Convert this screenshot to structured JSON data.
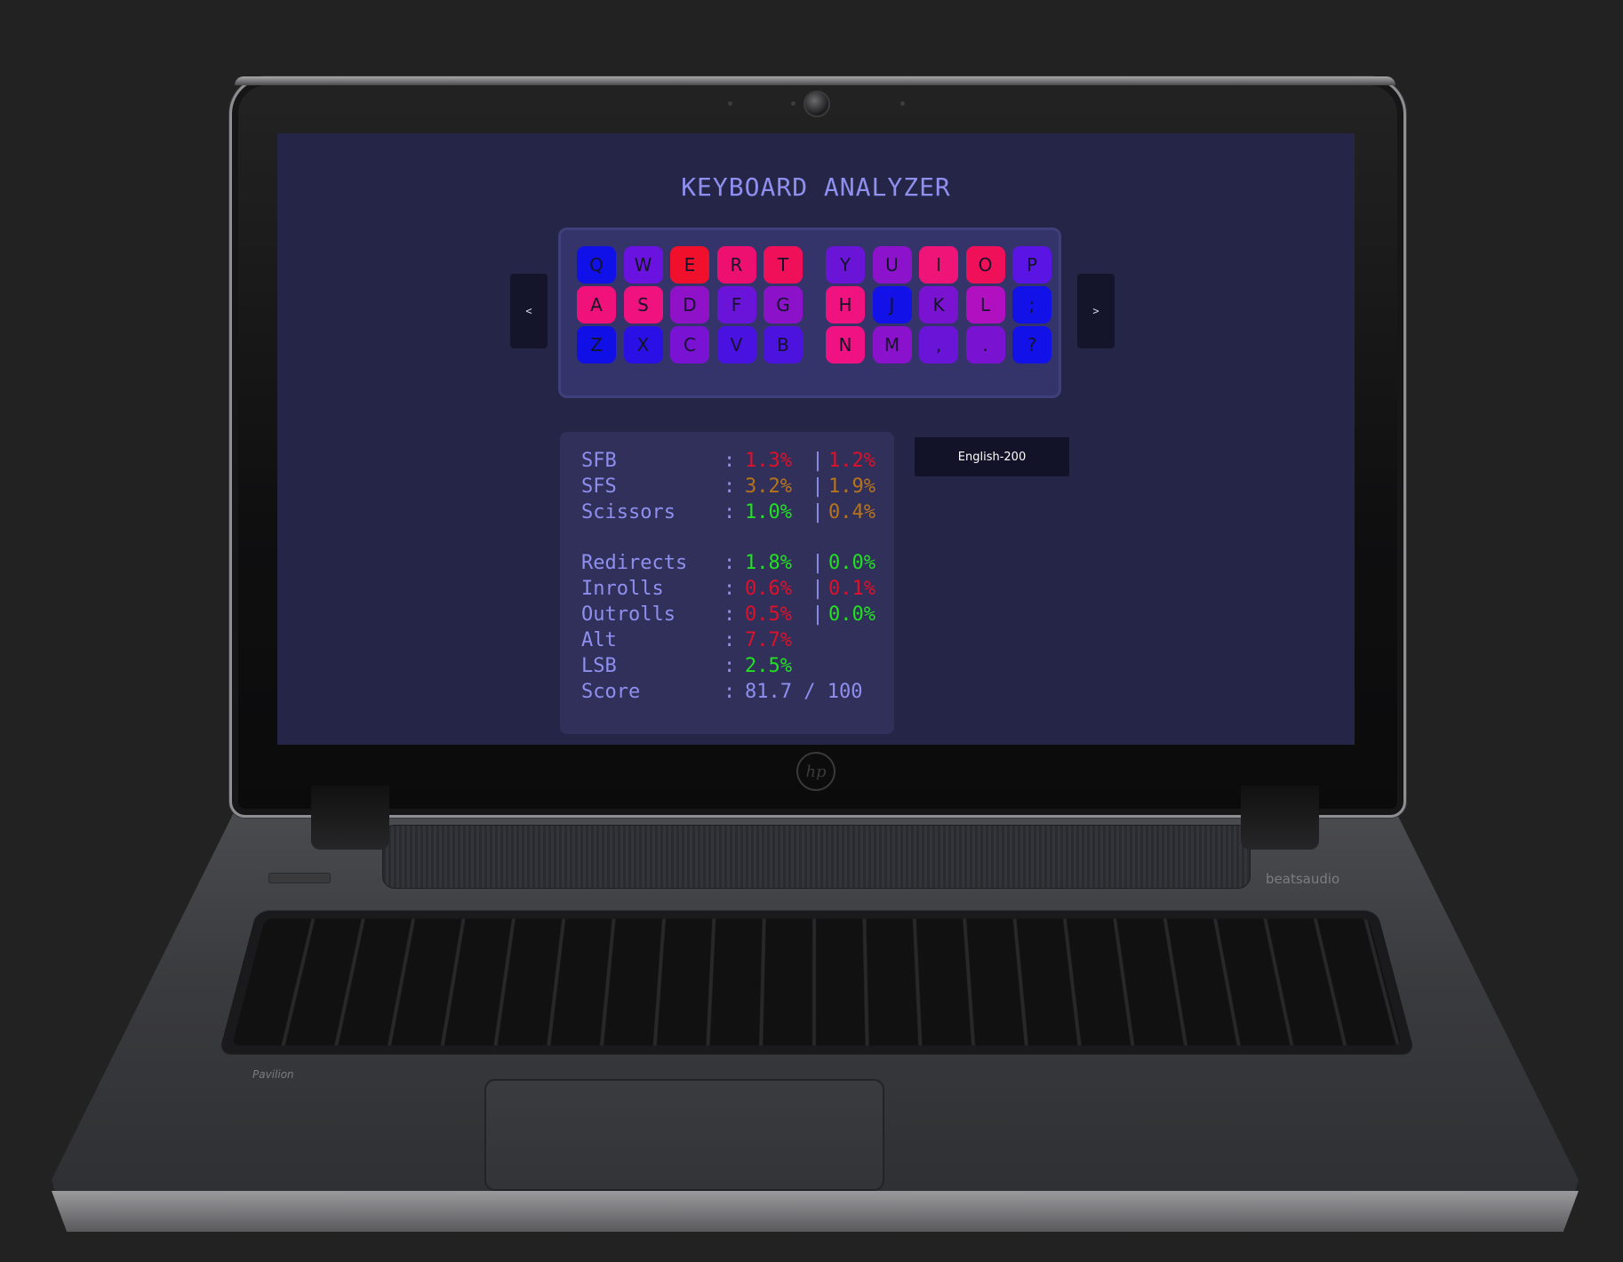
{
  "app": {
    "title": "KEYBOARD ANALYZER"
  },
  "colors": {
    "screen_bg": "#252647",
    "title": "#8f8ff0",
    "good": "#22e022",
    "warn": "#b8741a",
    "bad": "#e0102a",
    "neutral": "#8f8ff0"
  },
  "nav": {
    "prev_label": "<",
    "next_label": ">"
  },
  "keyboard": {
    "rows": [
      [
        {
          "label": "Q",
          "color": "#1010e8"
        },
        {
          "label": "W",
          "color": "#6a12e0"
        },
        {
          "label": "E",
          "color": "#f0102c"
        },
        {
          "label": "R",
          "color": "#ee1070"
        },
        {
          "label": "T",
          "color": "#f0105a"
        },
        {
          "label": "Y",
          "color": "#6a14d8"
        },
        {
          "label": "U",
          "color": "#8c12cc"
        },
        {
          "label": "I",
          "color": "#ee1478"
        },
        {
          "label": "O",
          "color": "#f0105a"
        },
        {
          "label": "P",
          "color": "#5a14e4"
        }
      ],
      [
        {
          "label": "A",
          "color": "#f0127a"
        },
        {
          "label": "S",
          "color": "#f0127e"
        },
        {
          "label": "D",
          "color": "#9012c8"
        },
        {
          "label": "F",
          "color": "#6a14da"
        },
        {
          "label": "G",
          "color": "#8c12ca"
        },
        {
          "label": "H",
          "color": "#f0127e"
        },
        {
          "label": "J",
          "color": "#1212e8"
        },
        {
          "label": "K",
          "color": "#7a12d2"
        },
        {
          "label": "L",
          "color": "#b010c0"
        },
        {
          "label": ";",
          "color": "#1212e8"
        }
      ],
      [
        {
          "label": "Z",
          "color": "#1010e6"
        },
        {
          "label": "X",
          "color": "#2a10e4"
        },
        {
          "label": "C",
          "color": "#7a12d4"
        },
        {
          "label": "V",
          "color": "#4a12e0"
        },
        {
          "label": "B",
          "color": "#4c12de"
        },
        {
          "label": "N",
          "color": "#f01282"
        },
        {
          "label": "M",
          "color": "#8a12cc"
        },
        {
          "label": ",",
          "color": "#6a14d8"
        },
        {
          "label": ".",
          "color": "#7a12d2"
        },
        {
          "label": "?",
          "color": "#1212e8"
        }
      ]
    ]
  },
  "stats": [
    {
      "label": "SFB",
      "v1": "1.3%",
      "c1": "bad",
      "v2": "1.2%",
      "c2": "bad"
    },
    {
      "label": "SFS",
      "v1": "3.2%",
      "c1": "warn",
      "v2": "1.9%",
      "c2": "warn"
    },
    {
      "label": "Scissors",
      "v1": "1.0%",
      "c1": "good",
      "v2": "0.4%",
      "c2": "warn"
    },
    {
      "label": "Redirects",
      "v1": "1.8%",
      "c1": "good",
      "v2": "0.0%",
      "c2": "good"
    },
    {
      "label": "Inrolls",
      "v1": "0.6%",
      "c1": "bad",
      "v2": "0.1%",
      "c2": "bad"
    },
    {
      "label": "Outrolls",
      "v1": "0.5%",
      "c1": "bad",
      "v2": "0.0%",
      "c2": "good"
    },
    {
      "label": "Alt",
      "v1": "7.7%",
      "c1": "bad",
      "v2": "",
      "c2": "neutral"
    },
    {
      "label": "LSB",
      "v1": "2.5%",
      "c1": "good",
      "v2": "",
      "c2": "neutral"
    },
    {
      "label": "Score",
      "v1": "81.7 / 100",
      "c1": "neutral",
      "v2": "",
      "c2": "neutral"
    }
  ],
  "stat_separator": ":",
  "stat_divider": "|",
  "corpus": {
    "selected": "English-200"
  },
  "device_labels": {
    "logo": "hp",
    "speaker_brand": "beatsaudio",
    "model": "Pavilion"
  }
}
